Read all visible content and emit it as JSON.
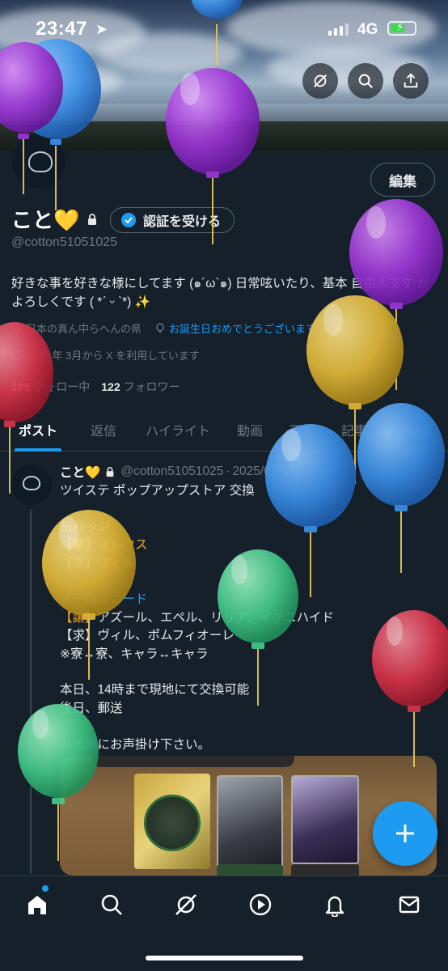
{
  "status_bar": {
    "time": "23:47",
    "network": "4G",
    "battery_percent": 60
  },
  "header": {
    "actions": [
      "grok-icon",
      "search-icon",
      "share-icon"
    ]
  },
  "profile": {
    "display_name": "こと💛",
    "handle": "@cotton51051025",
    "edit_label": "編集",
    "verify_label": "認証を受ける",
    "bio": "好きな事を好きな様にしてます (๑´ω`๑) 日常呟いたり、基本 自由人です がよろしくです ( *ˊ ᵕ ˋ*) ✨",
    "location": "日本の真ん中らへんの県",
    "birthday_text": "お誕生日おめでとうございます",
    "joined": "2020 年 3月から X を利用しています",
    "following_count": "185",
    "following_label": "フォロー中",
    "followers_count": "122",
    "followers_label": "フォロワー"
  },
  "tabs": [
    {
      "label": "ポスト",
      "active": true
    },
    {
      "label": "返信",
      "active": false
    },
    {
      "label": "ハイライト",
      "active": false
    },
    {
      "label": "動画",
      "active": false
    },
    {
      "label": "画像",
      "active": false
    },
    {
      "label": "記事",
      "active": false
    },
    {
      "label": "いいね",
      "active": false
    }
  ],
  "post": {
    "author": "こと💛",
    "handle": "@cotton51051025",
    "separator": "·",
    "date": "2025/07/07",
    "lines": {
      "l1": "ツイステ ポップアップストア 交換",
      "l2": "缶バッジ",
      "l3a": "【譲】",
      "l3b": "マレウス",
      "l4a": "【求】",
      "l4b": "ヴィル",
      "l5": "オーロラカード",
      "l6a": "【譲】",
      "l6b": "アズール、エペル、リリア、イグニハイド",
      "l7": "【求】ヴィル、ポムフィオーレ",
      "l8": "※寮↔寮、キャラ↔キャラ",
      "l9": "本日、14時まで現地にて交換可能",
      "l10": "後日、郵送",
      "l11a": "お気軽",
      "l11b": "にお声掛け下さい。"
    }
  },
  "fab": {
    "icon": "plus-icon"
  },
  "bottom_nav": [
    "home-icon",
    "search-icon",
    "grok-icon",
    "video-icon",
    "notifications-icon",
    "messages-icon"
  ],
  "colors": {
    "background": "#15202b",
    "accent": "#1d9bf0",
    "muted": "#71767b",
    "border": "#38444d"
  }
}
